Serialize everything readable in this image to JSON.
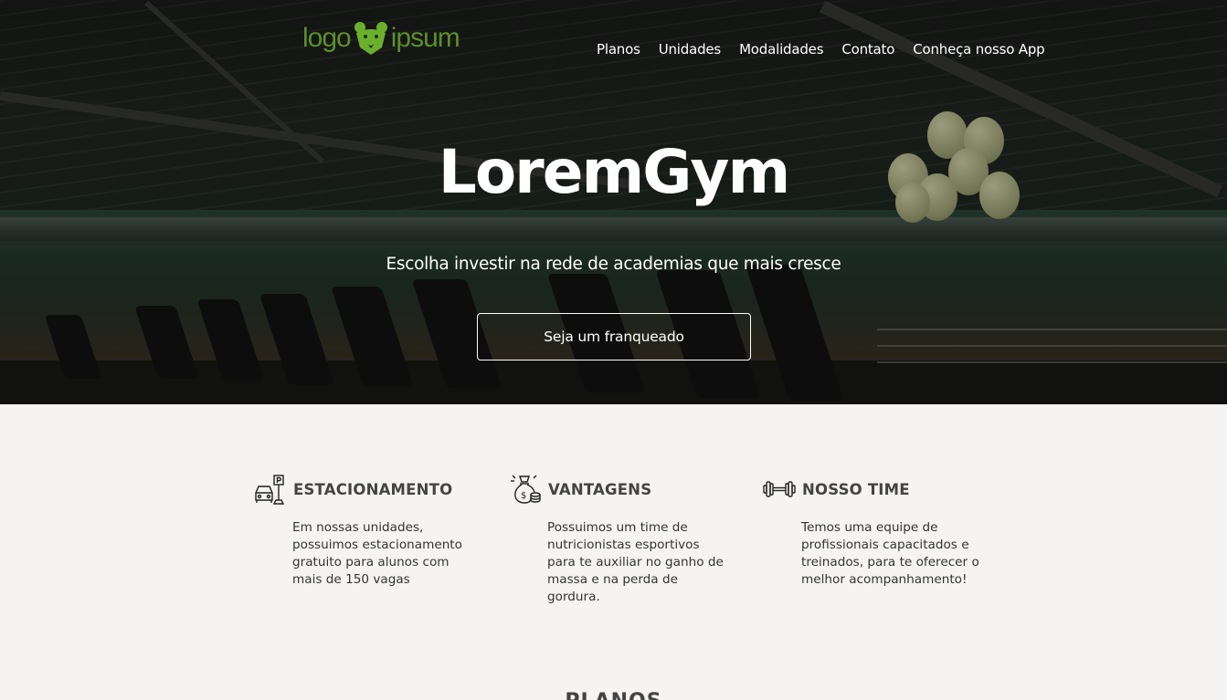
{
  "brand": {
    "logo_word_1": "logo",
    "logo_word_2": "ipsum",
    "logo_color": "#5b8f2d"
  },
  "nav": {
    "items": [
      {
        "label": "Planos"
      },
      {
        "label": "Unidades"
      },
      {
        "label": "Modalidades"
      },
      {
        "label": "Contato"
      },
      {
        "label": "Conheça nosso App"
      }
    ]
  },
  "hero": {
    "title": "LoremGym",
    "subtitle": "Escolha investir na rede de academias que mais cresce",
    "cta_label": "Seja um franqueado"
  },
  "features": [
    {
      "icon": "parking-car-icon",
      "title": "ESTACIONAMENTO",
      "text": "Em nossas unidades, possuimos estacionamento gratuito para alunos com mais de 150 vagas"
    },
    {
      "icon": "money-bag-icon",
      "title": "VANTAGENS",
      "text": "Possuimos um time de nutricionistas esportivos para te auxiliar no ganho de massa e na perda de gordura."
    },
    {
      "icon": "dumbbell-icon",
      "title": "NOSSO TIME",
      "text": "Temos uma equipe de profissionais capacitados e treinados, para te oferecer o melhor acompanhamento!"
    }
  ],
  "section_heading": "PLANOS",
  "colors": {
    "page_background": "#f5f4f2",
    "hero_text": "#ffffff",
    "heading_text": "#444444"
  }
}
